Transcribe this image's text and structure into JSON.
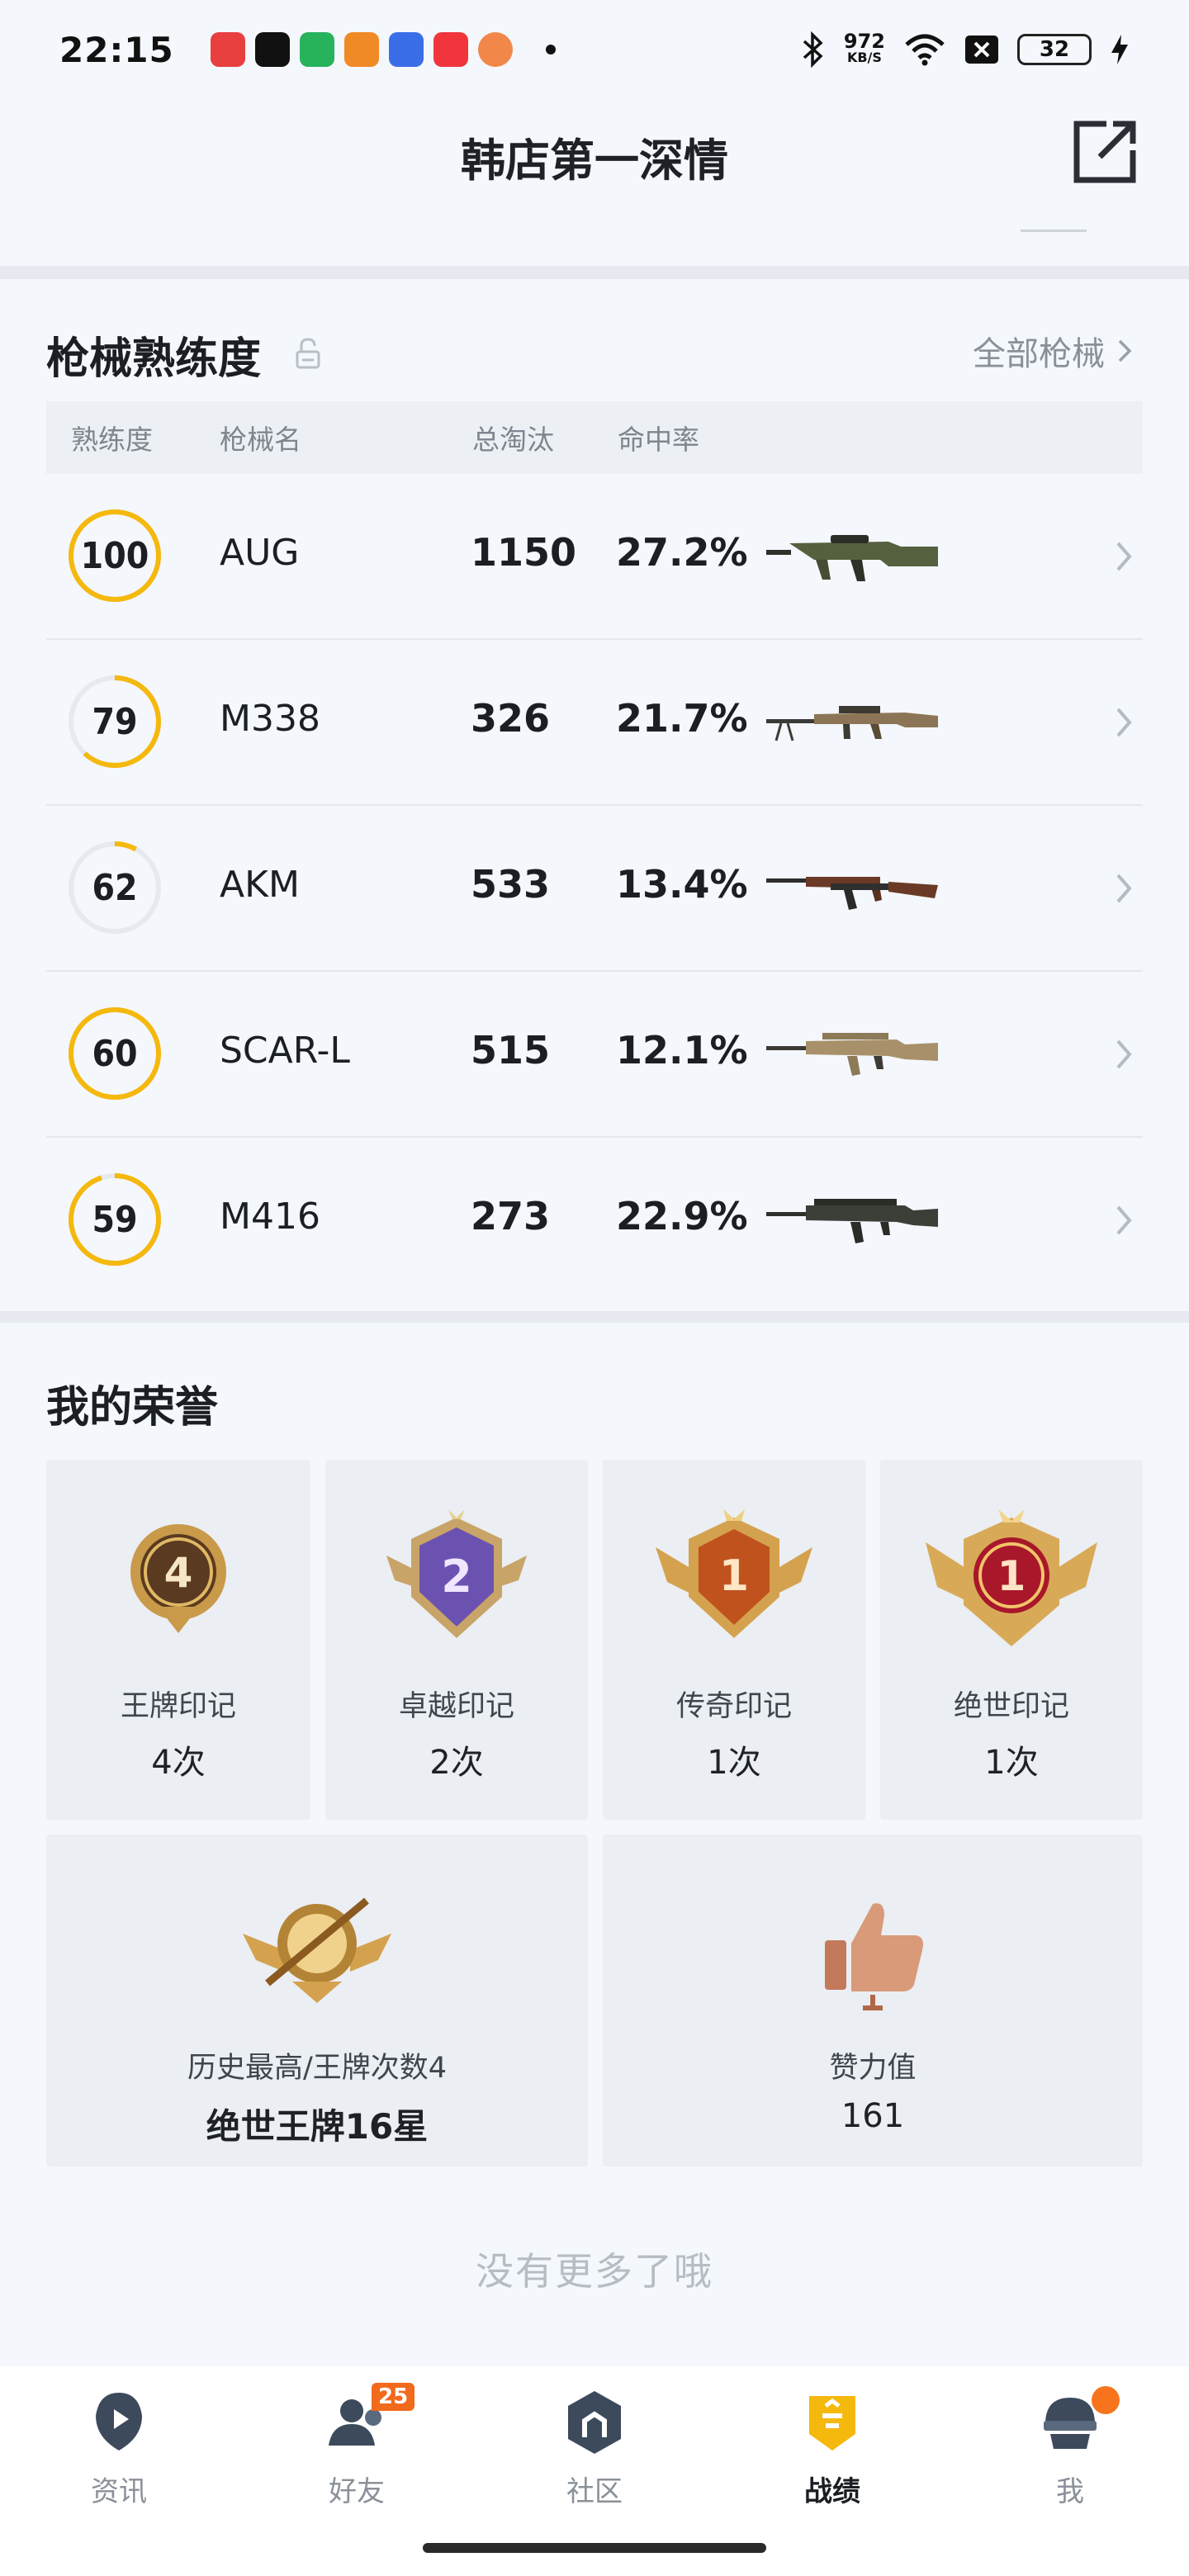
{
  "status_bar": {
    "time": "22:15",
    "net_speed_value": "972",
    "net_speed_unit": "KB/S",
    "battery": "32",
    "icons": [
      "bluetooth-icon",
      "wifi-icon",
      "sim-off-icon",
      "charging-icon"
    ],
    "app_colors": [
      "#e83f3f",
      "#111111",
      "#27b35c",
      "#f08a24",
      "#3a6ee8",
      "#f0353d",
      "#f2874a"
    ]
  },
  "header": {
    "title": "韩店第一深情",
    "share_icon": "share-icon"
  },
  "weapons": {
    "title": "枪械熟练度",
    "all_label": "全部枪械",
    "columns": {
      "proficiency": "熟练度",
      "name": "枪械名",
      "kills": "总淘汰",
      "hit_rate": "命中率"
    },
    "rows": [
      {
        "proficiency": "100",
        "name": "AUG",
        "kills": "1150",
        "hit_rate": "27.2%",
        "progress": 1.0
      },
      {
        "proficiency": "79",
        "name": "M338",
        "kills": "326",
        "hit_rate": "21.7%",
        "progress": 0.62
      },
      {
        "proficiency": "62",
        "name": "AKM",
        "kills": "533",
        "hit_rate": "13.4%",
        "progress": 0.08
      },
      {
        "proficiency": "60",
        "name": "SCAR-L",
        "kills": "515",
        "hit_rate": "12.1%",
        "progress": 1.0
      },
      {
        "proficiency": "59",
        "name": "M416",
        "kills": "273",
        "hit_rate": "22.9%",
        "progress": 0.95
      }
    ],
    "accent_color": "#f5b80d"
  },
  "honors": {
    "title": "我的荣誉",
    "cards": [
      {
        "label": "王牌印记",
        "count": "4次",
        "badge_number": "4"
      },
      {
        "label": "卓越印记",
        "count": "2次",
        "badge_number": "2"
      },
      {
        "label": "传奇印记",
        "count": "1次",
        "badge_number": "1"
      },
      {
        "label": "绝世印记",
        "count": "1次",
        "badge_number": "1"
      }
    ],
    "history": {
      "label": "历史最高/王牌次数4",
      "value": "绝世王牌16星"
    },
    "likes": {
      "label": "赞力值",
      "value": "161"
    }
  },
  "footer_text": "没有更多了哦",
  "nav": {
    "items": [
      {
        "label": "资讯",
        "icon": "news-icon"
      },
      {
        "label": "好友",
        "icon": "friends-icon",
        "badge": "25"
      },
      {
        "label": "社区",
        "icon": "community-icon"
      },
      {
        "label": "战绩",
        "icon": "record-icon",
        "active": true
      },
      {
        "label": "我",
        "icon": "profile-icon"
      }
    ]
  }
}
